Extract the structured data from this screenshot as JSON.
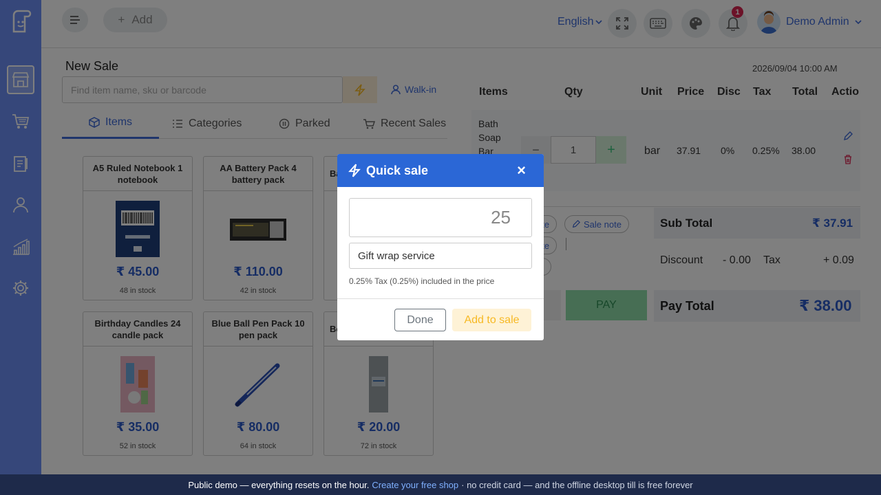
{
  "sidebar": {
    "items": [
      "store",
      "cart",
      "clipboard",
      "user",
      "chart",
      "settings"
    ],
    "active": "store"
  },
  "topbar": {
    "add_label": "Add",
    "language": "English",
    "notification_count": "1",
    "user_name": "Demo Admin"
  },
  "sale": {
    "title": "New  Sale",
    "search_placeholder": "Find item name, sku or barcode",
    "walkin_label": "Walk-in",
    "datetime": "2026/09/04 10:00 AM"
  },
  "tabs": [
    {
      "label": "Items",
      "icon": "box-icon"
    },
    {
      "label": "Categories",
      "icon": "list-icon"
    },
    {
      "label": "Parked",
      "icon": "pause-icon"
    },
    {
      "label": "Recent Sales",
      "icon": "cart-icon"
    }
  ],
  "products": [
    {
      "name": "A5 Ruled Notebook 1 notebook",
      "price": "₹ 45.00",
      "stock": "48 in stock"
    },
    {
      "name": "AA Battery Pack 4 battery pack",
      "price": "₹ 110.00",
      "stock": "42 in stock"
    },
    {
      "name": "Ba",
      "price": "",
      "stock": ""
    },
    {
      "name": "Birthday Candles 24 candle pack",
      "price": "₹ 35.00",
      "stock": "52 in stock"
    },
    {
      "name": "Blue Ball Pen Pack 10 pen pack",
      "price": "₹ 80.00",
      "stock": "64 in stock"
    },
    {
      "name": "Bo",
      "price": "₹ 20.00",
      "stock": "72 in stock"
    }
  ],
  "cart": {
    "headers": [
      "Items",
      "Qty",
      "Unit",
      "Price",
      "Disc",
      "Tax",
      "Total",
      "Actio"
    ],
    "row": {
      "item": "Bath Soap Bar",
      "qty": "1",
      "unit": "bar",
      "price": "37.91",
      "disc": "0%",
      "tax": "0.25%",
      "total": "38.00"
    },
    "notes": [
      "ote",
      "Sale note",
      "ote",
      "t"
    ],
    "subtotal_label": "Sub Total",
    "subtotal": "₹ 37.91",
    "discount_label": "Discount",
    "discount": "- 0.00",
    "tax_label": "Tax",
    "tax": "+ 0.09",
    "pay_label": "PAY",
    "paytotal_label": "Pay Total",
    "paytotal": "₹ 38.00"
  },
  "modal": {
    "title": "Quick sale",
    "amount": "25",
    "description": "Gift wrap service",
    "tax_note": "0.25% Tax (0.25%) included in the price",
    "done_label": "Done",
    "add_label": "Add to sale"
  },
  "banner": {
    "text": "Public demo — everything resets on the hour.",
    "link": "Create your free shop",
    "rest": "· no credit card — and the offline desktop till is free forever"
  }
}
